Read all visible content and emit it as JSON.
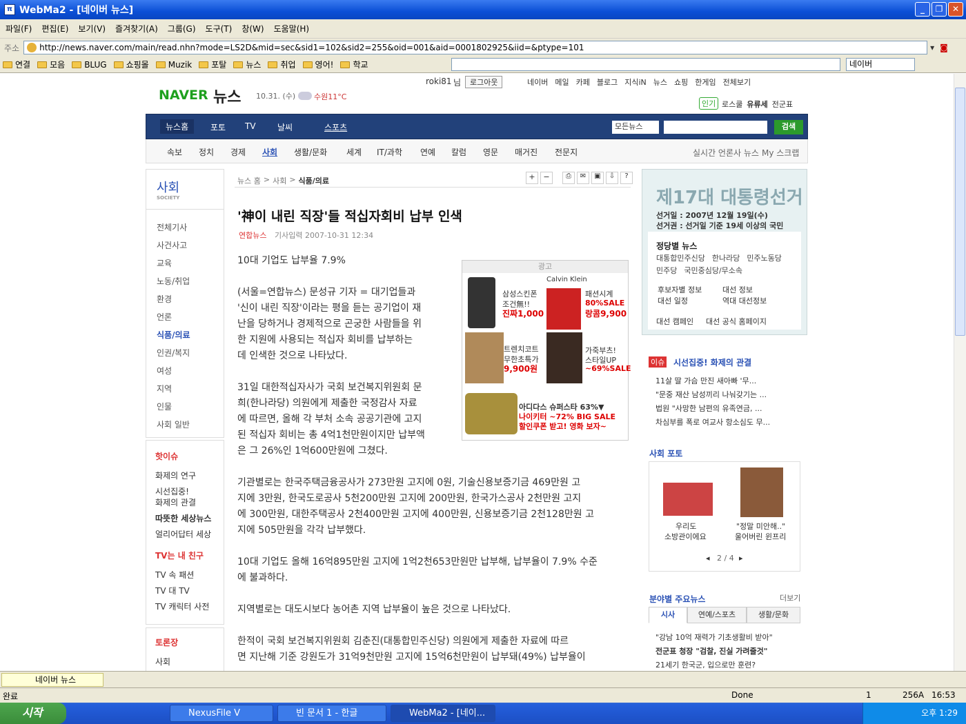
{
  "window": {
    "title": "WebMa2 - [네이버 뉴스]",
    "icon_label": "π"
  },
  "menu": [
    "파일(F)",
    "편집(E)",
    "보기(V)",
    "즐겨찾기(A)",
    "그룹(G)",
    "도구(T)",
    "창(W)",
    "도움말(H)"
  ],
  "address": {
    "label": "주소",
    "url": "http://news.naver.com/main/read.nhn?mode=LS2D&mid=sec&sid1=102&sid2=255&oid=001&aid=0001802925&iid=&ptype=101"
  },
  "favorites": [
    "연결",
    "모음",
    "BLUG",
    "쇼핑몰",
    "Muzik",
    "포탈",
    "뉴스",
    "취업",
    "영어!",
    "학교"
  ],
  "search_engine": "네이버",
  "page": {
    "user": "roki81",
    "user_suffix": "님",
    "logout": "로그아웃",
    "toplinks": [
      "네이버",
      "메일",
      "카페",
      "블로그",
      "지식iN",
      "뉴스",
      "쇼핑",
      "한게임",
      "전체보기"
    ],
    "logo_naver": "NAVER",
    "logo_news": "뉴스",
    "date": "10.31. (수)",
    "weather": "수원11°C",
    "popular_label": "인기",
    "popular_items": [
      "로스쿨",
      "유류세",
      "전군표"
    ],
    "navy_items": [
      "뉴스홈",
      "포토",
      "TV",
      "날씨",
      "스포츠"
    ],
    "search_scope": "모든뉴스",
    "search_button": "검색",
    "subnav": [
      "속보",
      "정치",
      "경제",
      "사회",
      "생활/문화",
      "세계",
      "IT/과학",
      "연예",
      "칼럼",
      "영문",
      "매거진",
      "전문지"
    ],
    "subnav_right": [
      "실시간 언론사 뉴스",
      "My 스크랩"
    ],
    "section_title": "사회",
    "section_sub": "SOCIETY",
    "left_items": [
      "전체기사",
      "사건사고",
      "교육",
      "노동/취업",
      "환경",
      "언론",
      "식품/의료",
      "인권/복지",
      "여성",
      "지역",
      "인물",
      "사회 일반"
    ],
    "hot_title": "핫이슈",
    "hot_items": [
      "화제의 연구",
      "시선집중!",
      "화제의 관결",
      "따뜻한 세상뉴스",
      "얼리어답터 세상"
    ],
    "tv_title": "TV는 내 친구",
    "tv_items": [
      "TV 속 패션",
      "TV 대 TV",
      "TV 캐릭터 사전"
    ],
    "debate_title": "토론장",
    "debate_items": [
      "사회"
    ],
    "breadcrumb": [
      "뉴스 홈",
      "사회",
      "식품/의료"
    ],
    "article_title": "'神이 내린 직장'들 적십자회비 납부 인색",
    "source": "연합뉴스",
    "date_label": "기사입력 2007-10-31 12:34",
    "paras": [
      "10대 기업도 납부율 7.9%",
      "(서울=연합뉴스) 문성규 기자 = 대기업들과",
      "'신이 내린 직장'이라는 평을 듣는 공기업이 재",
      "난을 당하거나 경제적으로 곤궁한 사람들을 위",
      "한 지원에 사용되는 적십자 회비를 납부하는",
      "데 인색한 것으로 나타났다.",
      "31일 대한적십자사가 국회 보건복지위원회 문",
      "희(한나라당) 의원에게 제출한 국정감사 자료",
      "에 따르면, 올해 각 부처 소속 공공기관에 고지",
      "된 적십자 회비는 총 4억1천만원이지만 납부액",
      "은 그 26%인 1억600만원에 그쳤다.",
      "기관별로는 한국주택금융공사가 273만원 고지에 0원, 기술신용보증기금 469만원 고",
      "지에 3만원, 한국도로공사 5천200만원 고지에 200만원, 한국가스공사 2천만원 고지",
      "에 300만원, 대한주택공사 2천400만원 고지에 400만원, 신용보증기금 2천128만원 고",
      "지에 505만원을 각각 납부했다.",
      "10대 기업도 올해 16억895만원 고지에 1억2천653만원만 납부해, 납부율이 7.9% 수준",
      "에 불과하다.",
      "지역별로는 대도시보다 농어촌 지역 납부율이 높은 것으로 나타났다.",
      "한적이 국회 보건복지위원회 김춘진(대통합민주신당) 의원에게 제출한 자료에 따르",
      "면 지난해 기준 강원도가 31억9천만원 고지에 15억6천만원이 납부돼(49%) 납부율이"
    ],
    "ad_label": "광고",
    "ads": [
      {
        "line1": "삼성스킨폰",
        "line2": "조건無!!",
        "line3": "진짜1,000"
      },
      {
        "line0": "Calvin Klein",
        "line1": "패션시계",
        "line2": "80%SALE",
        "line3": "랑콤9,900"
      },
      {
        "line1": "트렌치코트",
        "line2": "무한초특가",
        "line3": "9,900원"
      },
      {
        "line1": "가죽부츠!",
        "line2": "스타일UP",
        "line3": "~69%SALE"
      },
      {
        "line1": "아디다스 슈퍼스타 63%▼",
        "line2": "나이키터 ~72% BIG SALE",
        "line3": "할인쿠폰 받고! 영화 보자~"
      }
    ],
    "election": {
      "title": "제17대 대통령선거",
      "date": "선거일 : 2007년 12월 19일(수)",
      "eligibility": "선거권 : 선거일 기준 19세 이상의 국민",
      "party_title": "정당별 뉴스",
      "parties": [
        "대통합민주신당",
        "한나라당",
        "민주노동당",
        "민주당",
        "국민중심당/무소속"
      ],
      "links": [
        "후보자별 정보",
        "대선 정보",
        "대선 일정",
        "역대 대선정보"
      ],
      "bottom": [
        "대선 캠페인",
        "대선 공식 홈페이지"
      ]
    },
    "issue_badge": "이슈",
    "issue_title": "시선집중! 화제의 관결",
    "issue_items": [
      "11살 딸 가슴 만진 새아빠 '무...",
      "\"문중 재산 남성끼리 나눠갖기는 ...",
      "법원 \"사망한 남편의 유족연금, ...",
      "차심부를 폭로 여교사 항소심도 무..."
    ],
    "photo_title": "사회 포토",
    "photos": [
      {
        "cap1": "우리도",
        "cap2": "소방관이에요"
      },
      {
        "cap1": "\"정말 미안해..\"",
        "cap2": "울어버린 윈프리"
      }
    ],
    "photo_pager": "2 / 4",
    "field_title": "분야별 주요뉴스",
    "more": "더보기",
    "field_tabs": [
      "시사",
      "연예/스포츠",
      "생활/문화"
    ],
    "field_items": [
      "\"강남 10억 재력가 기초생활비 받아\"",
      "전군표 청장 \"검찰, 진실 가려줄것\"",
      "21세기 한국군, 입으로만 훈련?"
    ]
  },
  "doctab": "네이버 뉴스",
  "status": {
    "left": "완료",
    "done": "Done",
    "count": "1",
    "mem": "256A",
    "time": "16:53"
  },
  "taskbar": {
    "start": "시작",
    "tasks": [
      "NexusFile V",
      "빈 문서 1 - 한글",
      "WebMa2 - [네이..."
    ],
    "clock": "오후 1:29"
  }
}
